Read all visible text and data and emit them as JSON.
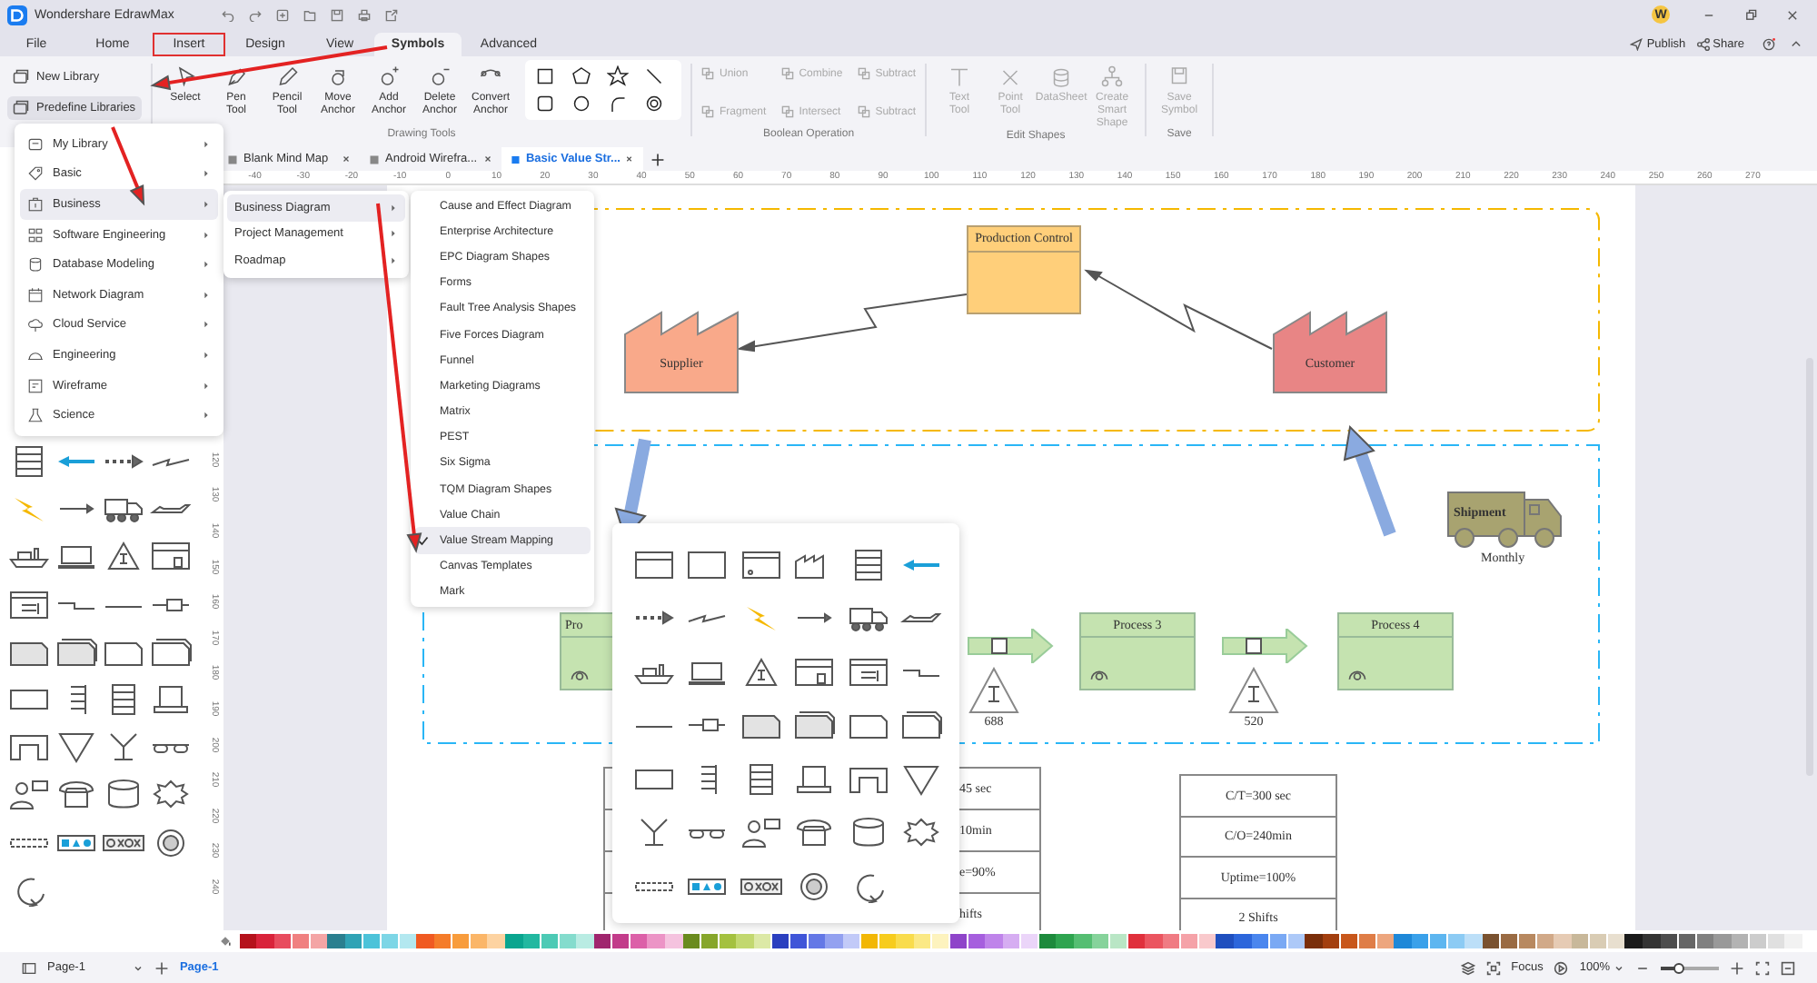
{
  "app": {
    "title": "Wondershare EdrawMax",
    "avatar_initial": "W"
  },
  "menu_tabs": [
    {
      "label": "File",
      "selected": false,
      "outlined": false
    },
    {
      "label": "Home",
      "selected": false,
      "outlined": false
    },
    {
      "label": "Insert",
      "selected": false,
      "outlined": true
    },
    {
      "label": "Design",
      "selected": false,
      "outlined": false
    },
    {
      "label": "View",
      "selected": false,
      "outlined": false
    },
    {
      "label": "Symbols",
      "selected": true,
      "outlined": false
    },
    {
      "label": "Advanced",
      "selected": false,
      "outlined": false
    }
  ],
  "header_actions": [
    "Publish",
    "Share"
  ],
  "ribbon": {
    "library_buttons": [
      {
        "label": "New Library",
        "selected": false
      },
      {
        "label": "Predefine Libraries",
        "selected": true
      }
    ],
    "drawing_tools": [
      "Select",
      "Pen Tool",
      "Pencil Tool",
      "Move Anchor",
      "Add Anchor",
      "Delete Anchor",
      "Convert Anchor"
    ],
    "drawing_group": "Drawing Tools",
    "boolean_ops": [
      "Union",
      "Fragment",
      "Combine",
      "Intersect",
      "Subtract",
      "Subtract"
    ],
    "boolean_group": "Boolean Operation",
    "edit_tools": [
      "Text Tool",
      "Point Tool",
      "DataSheet",
      "Create Smart Shape"
    ],
    "edit_group": "Edit Shapes",
    "save_tools": [
      "Save Symbol"
    ],
    "save_group": "Save"
  },
  "doc_tabs": [
    {
      "label": "Blank Mind Map",
      "selected": false
    },
    {
      "label": "Android Wirefra...",
      "selected": false
    },
    {
      "label": "Basic Value Str...",
      "selected": true
    }
  ],
  "ruler": {
    "horizontal": [
      "-40",
      "-30",
      "-20",
      "-10",
      "0",
      "10",
      "20",
      "30",
      "40",
      "50",
      "60",
      "70",
      "80",
      "90",
      "100",
      "110",
      "120",
      "130",
      "140",
      "150",
      "160",
      "170",
      "180",
      "190",
      "200",
      "210",
      "220",
      "230",
      "240",
      "250",
      "260",
      "270"
    ],
    "vertical": [
      "120",
      "130",
      "140",
      "150",
      "160",
      "170",
      "180",
      "190",
      "200",
      "210",
      "220",
      "230",
      "240"
    ]
  },
  "library_menu": {
    "items": [
      {
        "label": "My Library",
        "selected": false
      },
      {
        "label": "Basic",
        "selected": false
      },
      {
        "label": "Business",
        "selected": true
      },
      {
        "label": "Software Engineering",
        "selected": false
      },
      {
        "label": "Database Modeling",
        "selected": false
      },
      {
        "label": "Network Diagram",
        "selected": false
      },
      {
        "label": "Cloud Service",
        "selected": false
      },
      {
        "label": "Engineering",
        "selected": false
      },
      {
        "label": "Wireframe",
        "selected": false
      },
      {
        "label": "Science",
        "selected": false
      }
    ],
    "submenu": [
      {
        "label": "Business Diagram",
        "selected": true
      },
      {
        "label": "Project Management",
        "selected": false
      },
      {
        "label": "Roadmap",
        "selected": false
      }
    ],
    "submenu2": [
      {
        "label": "Cause and Effect Diagram",
        "checked": false
      },
      {
        "label": "Enterprise Architecture",
        "checked": false
      },
      {
        "label": "EPC Diagram Shapes",
        "checked": false
      },
      {
        "label": "Forms",
        "checked": false
      },
      {
        "label": "Fault Tree Analysis Shapes",
        "checked": false
      },
      {
        "label": "Five Forces Diagram",
        "checked": false
      },
      {
        "label": "Funnel",
        "checked": false
      },
      {
        "label": "Marketing Diagrams",
        "checked": false
      },
      {
        "label": "Matrix",
        "checked": false
      },
      {
        "label": "PEST",
        "checked": false
      },
      {
        "label": "Six Sigma",
        "checked": false
      },
      {
        "label": "TQM Diagram Shapes",
        "checked": false
      },
      {
        "label": "Value Chain",
        "checked": false
      },
      {
        "label": "Value Stream Mapping",
        "checked": true
      },
      {
        "label": "Canvas Templates",
        "checked": false
      },
      {
        "label": "Mark",
        "checked": false
      }
    ]
  },
  "diagram": {
    "production_control": "Production Control",
    "supplier": "Supplier",
    "customer": "Customer",
    "shipment": {
      "label": "Shipment",
      "caption": "Monthly"
    },
    "processes": [
      {
        "label": "Pro"
      },
      {
        "label": "Process 3"
      },
      {
        "label": "Process 4"
      }
    ],
    "inventory": [
      "688",
      "520"
    ],
    "left_table": [
      "45 sec",
      "10min",
      "e=90%",
      "hifts"
    ],
    "right_table": [
      "C/T=300 sec",
      "C/O=240min",
      "Uptime=100%",
      "2 Shifts"
    ]
  },
  "palette": [
    {
      "color": "#b5121b"
    },
    {
      "color": "#d9233a"
    },
    {
      "color": "#e84c5e"
    },
    {
      "color": "#f08080"
    },
    {
      "color": "#f4a5a5"
    },
    {
      "color": "#2a7f8f"
    },
    {
      "color": "#2fa3b5"
    },
    {
      "color": "#4cc3d9"
    },
    {
      "color": "#7dd6e6"
    },
    {
      "color": "#b3e8f0"
    },
    {
      "color": "#f05a22"
    },
    {
      "color": "#f57c2a"
    },
    {
      "color": "#f89c3c"
    },
    {
      "color": "#fbb668"
    },
    {
      "color": "#fdd3a1"
    },
    {
      "color": "#0aa58f"
    },
    {
      "color": "#22b8a0"
    },
    {
      "color": "#4ccab5"
    },
    {
      "color": "#84dccd"
    },
    {
      "color": "#b9ece3"
    },
    {
      "color": "#a0266e"
    },
    {
      "color": "#c23b8a"
    },
    {
      "color": "#dc60a8"
    },
    {
      "color": "#ec94c6"
    },
    {
      "color": "#f5c3df"
    },
    {
      "color": "#6a8b1e"
    },
    {
      "color": "#86a62a"
    },
    {
      "color": "#a4c13f"
    },
    {
      "color": "#c2d86f"
    },
    {
      "color": "#dce9a6"
    },
    {
      "color": "#2a3fbf"
    },
    {
      "color": "#3f55d8"
    },
    {
      "color": "#6478e6"
    },
    {
      "color": "#93a1f0"
    },
    {
      "color": "#c2caf8"
    },
    {
      "color": "#f2b705"
    },
    {
      "color": "#f7cc1d"
    },
    {
      "color": "#f9dc4c"
    },
    {
      "color": "#fbe985"
    },
    {
      "color": "#fdf3be"
    },
    {
      "color": "#8e44c9"
    },
    {
      "color": "#a65fde"
    },
    {
      "color": "#bf84ea"
    },
    {
      "color": "#d6adf2"
    },
    {
      "color": "#ebd5f9"
    },
    {
      "color": "#1d8a3c"
    },
    {
      "color": "#2ea44f"
    },
    {
      "color": "#55be72"
    },
    {
      "color": "#86d39b"
    },
    {
      "color": "#b9e6c5"
    },
    {
      "color": "#e0303c"
    },
    {
      "color": "#eb5560"
    },
    {
      "color": "#f07b83"
    },
    {
      "color": "#f5a2a8"
    },
    {
      "color": "#f9c9cc"
    },
    {
      "color": "#1f4fbf"
    },
    {
      "color": "#2c66db"
    },
    {
      "color": "#4a86ee"
    },
    {
      "color": "#7aa9f4"
    },
    {
      "color": "#adc9f8"
    },
    {
      "color": "#7a2e0a"
    },
    {
      "color": "#a33f0f"
    },
    {
      "color": "#c8571b"
    },
    {
      "color": "#df7d47"
    },
    {
      "color": "#eda67e"
    },
    {
      "color": "#1e88d8"
    },
    {
      "color": "#3aa1ea"
    },
    {
      "color": "#5db6f0"
    },
    {
      "color": "#8ccbf4"
    },
    {
      "color": "#bcdff8"
    },
    {
      "color": "#7a5230"
    },
    {
      "color": "#9a6b43"
    },
    {
      "color": "#b88960"
    },
    {
      "color": "#d1a988"
    },
    {
      "color": "#e6cbb4"
    },
    {
      "color": "#c8b89a"
    },
    {
      "color": "#d9ccb4"
    },
    {
      "color": "#e8dfcf"
    },
    {
      "color": "#1a1a1a"
    },
    {
      "color": "#333333"
    },
    {
      "color": "#4d4d4d"
    },
    {
      "color": "#666666"
    },
    {
      "color": "#808080"
    },
    {
      "color": "#999999"
    },
    {
      "color": "#b3b3b3"
    },
    {
      "color": "#cccccc"
    },
    {
      "color": "#e0e0e0"
    },
    {
      "color": "#f2f2f2"
    }
  ],
  "status_bar": {
    "page_select": "Page-1",
    "page_tabs": [
      {
        "label": "Page-1",
        "selected": true
      }
    ],
    "focus": "Focus",
    "zoom": {
      "label": "100%",
      "level": 0.3
    }
  }
}
